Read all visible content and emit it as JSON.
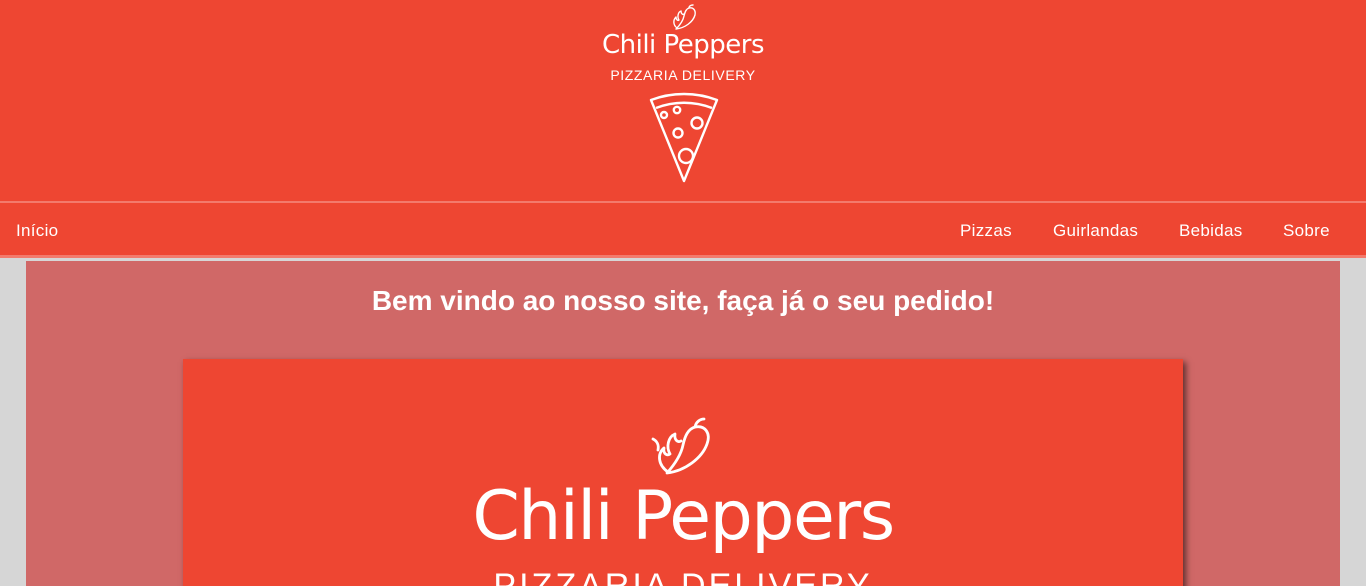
{
  "header": {
    "brand": "Chili Peppers",
    "tagline": "PIZZARIA DELIVERY",
    "icons": [
      "chili-pepper-icon",
      "pizza-slice-icon"
    ]
  },
  "nav": {
    "home": "Início",
    "items": [
      "Pizzas",
      "Guirlandas",
      "Bebidas",
      "Sobre"
    ]
  },
  "main": {
    "welcome": "Bem vindo ao nosso site, faça já o seu pedido!"
  },
  "banner": {
    "brand": "Chili Peppers",
    "tagline": "PIZZARIA DELIVERY"
  },
  "colors": {
    "primary": "#ee4632",
    "content_bg": "#d06867",
    "page_bg": "#d6d6d6",
    "text": "#ffffff"
  }
}
